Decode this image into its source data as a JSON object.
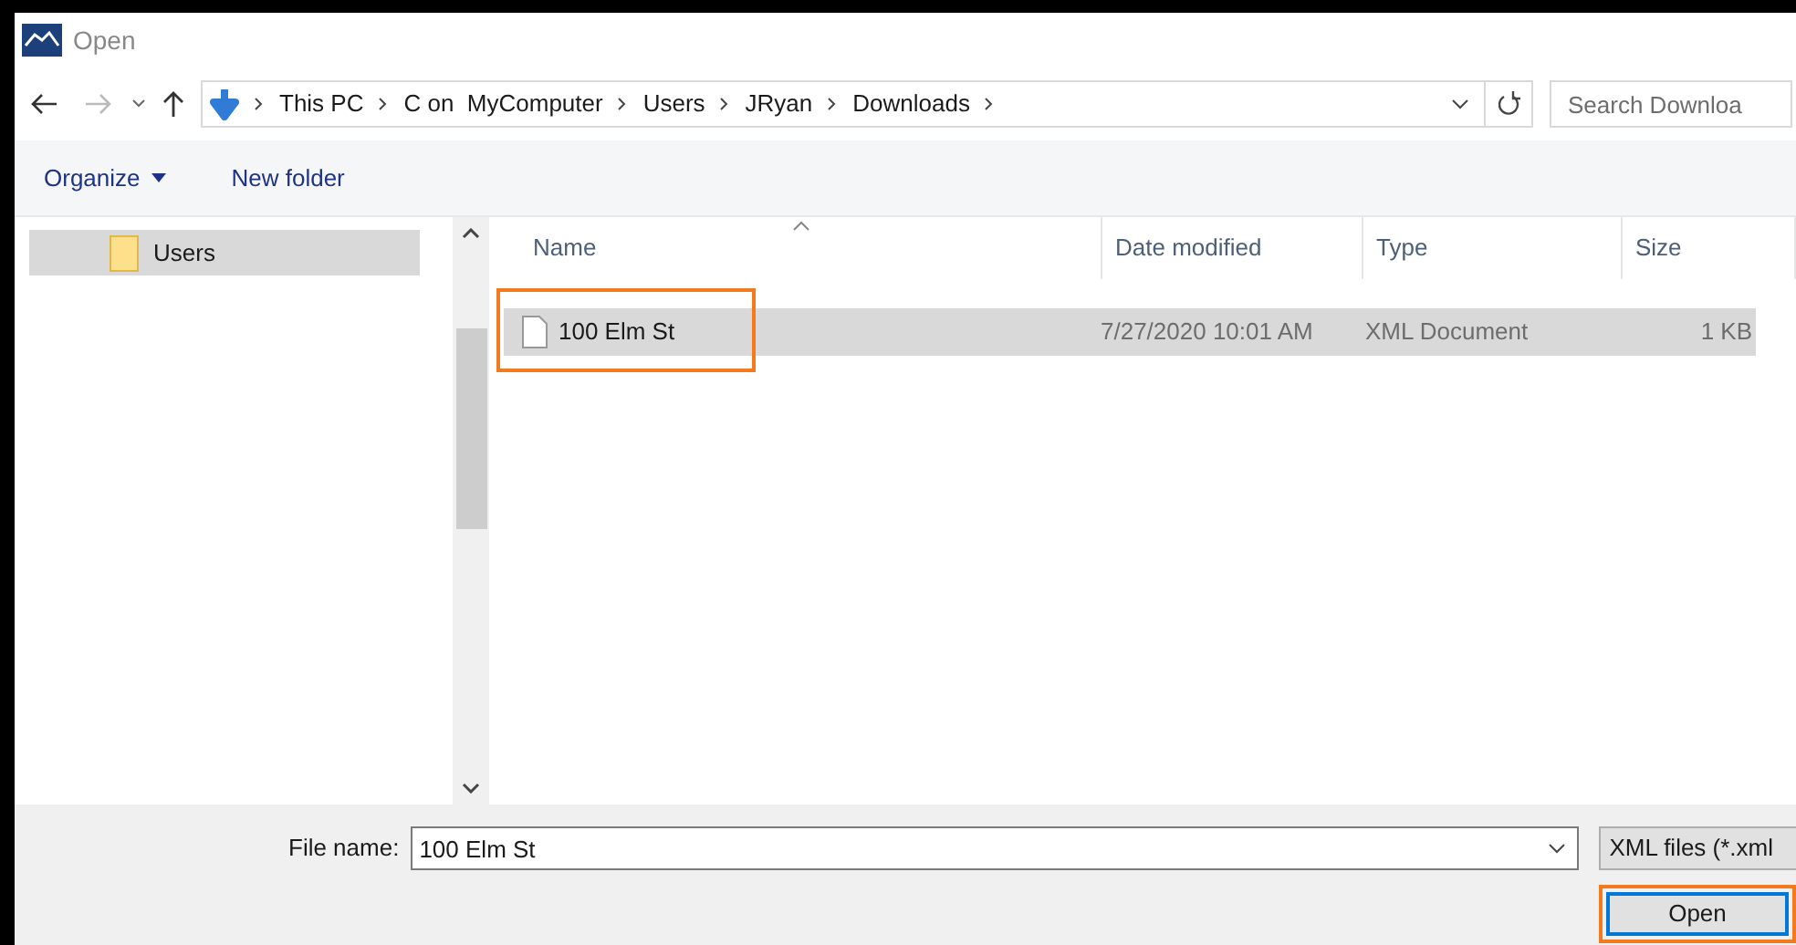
{
  "window": {
    "title": "Open"
  },
  "breadcrumb": [
    "This PC",
    "C on  MyComputer",
    "Users",
    "JRyan",
    "Downloads"
  ],
  "search": {
    "placeholder": "Search Downloa"
  },
  "toolbar": {
    "organize": "Organize",
    "new_folder": "New folder"
  },
  "sidebar": {
    "items": [
      {
        "label": "Users",
        "selected": true
      }
    ]
  },
  "table": {
    "columns": [
      "Name",
      "Date modified",
      "Type",
      "Size"
    ],
    "rows": [
      {
        "cells": [
          "100 Elm St",
          "7/27/2020 10:01 AM",
          "XML Document",
          "1 KB"
        ],
        "selected": true,
        "highlighted": true
      }
    ]
  },
  "file_name": {
    "label": "File name:",
    "value": "100 Elm St"
  },
  "file_type": {
    "value": "XML files (*.xml"
  },
  "open_button": {
    "label": "Open",
    "highlighted": true
  }
}
